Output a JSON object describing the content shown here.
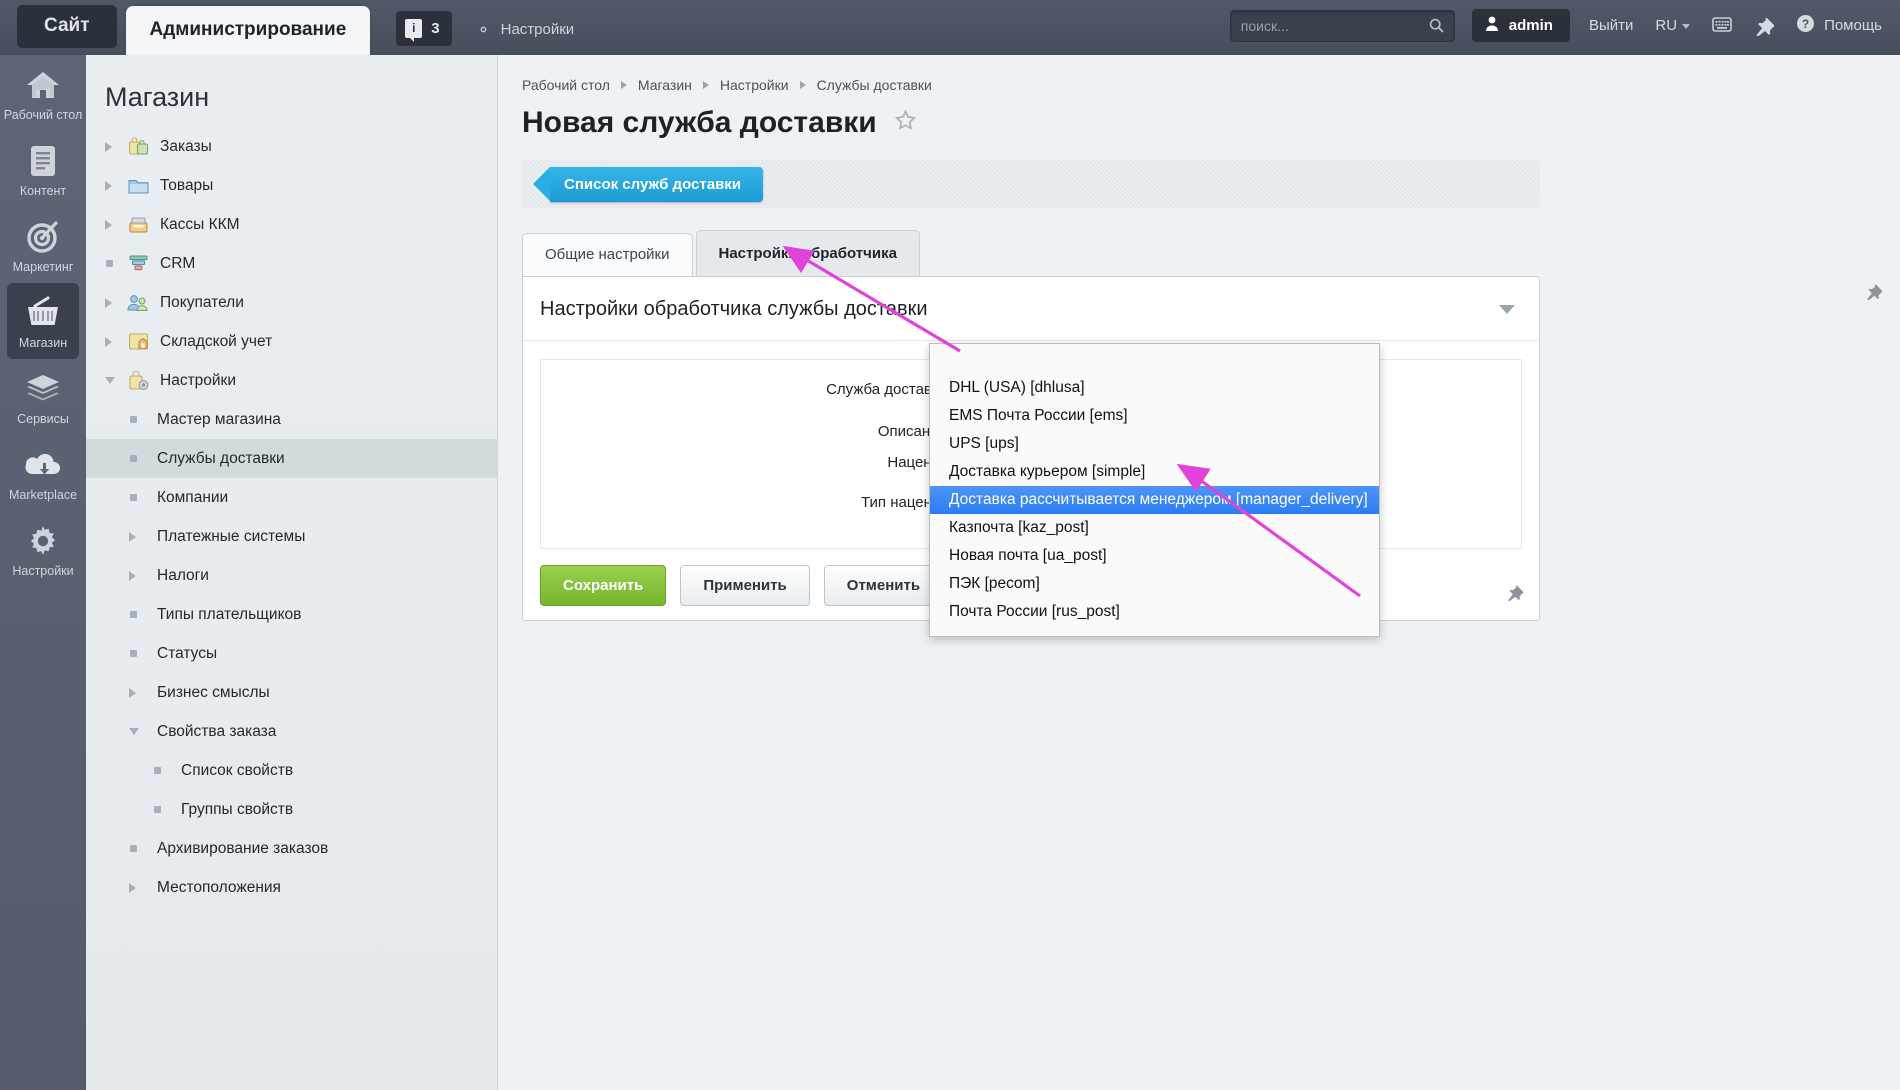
{
  "topbar": {
    "site_tab": "Сайт",
    "admin_tab": "Администрирование",
    "notify_count": "3",
    "settings_label": "Настройки",
    "search_placeholder": "поиск...",
    "user": "admin",
    "logout": "Выйти",
    "lang": "RU",
    "help": "Помощь"
  },
  "rail": {
    "items": [
      {
        "label": "Рабочий стол",
        "icon": "home-icon",
        "active": false
      },
      {
        "label": "Контент",
        "icon": "document-icon",
        "active": false
      },
      {
        "label": "Маркетинг",
        "icon": "target-icon",
        "active": false
      },
      {
        "label": "Магазин",
        "icon": "basket-icon",
        "active": true
      },
      {
        "label": "Сервисы",
        "icon": "layers-icon",
        "active": false
      },
      {
        "label": "Marketplace",
        "icon": "cloud-download-icon",
        "active": false
      },
      {
        "label": "Настройки",
        "icon": "gear-icon",
        "active": false
      }
    ]
  },
  "menu": {
    "title": "Магазин",
    "items": [
      {
        "label": "Заказы",
        "marker": "right",
        "level": 1,
        "icon": "bag-icon",
        "selected": false
      },
      {
        "label": "Товары",
        "marker": "right",
        "level": 1,
        "icon": "folder-icon",
        "selected": false
      },
      {
        "label": "Кассы ККМ",
        "marker": "right",
        "level": 1,
        "icon": "cashbox-icon",
        "selected": false
      },
      {
        "label": "CRM",
        "marker": "dot",
        "level": 1,
        "icon": "funnel-icon",
        "selected": false
      },
      {
        "label": "Покупатели",
        "marker": "right",
        "level": 1,
        "icon": "users-icon",
        "selected": false
      },
      {
        "label": "Складской учет",
        "marker": "right",
        "level": 1,
        "icon": "warehouse-icon",
        "selected": false
      },
      {
        "label": "Настройки",
        "marker": "down",
        "level": 1,
        "icon": "settings-bag-icon",
        "selected": false
      },
      {
        "label": "Мастер магазина",
        "marker": "dot",
        "level": 2,
        "icon": "",
        "selected": false
      },
      {
        "label": "Службы доставки",
        "marker": "dot",
        "level": 2,
        "icon": "",
        "selected": true
      },
      {
        "label": "Компании",
        "marker": "dot",
        "level": 2,
        "icon": "",
        "selected": false
      },
      {
        "label": "Платежные системы",
        "marker": "right",
        "level": 2,
        "icon": "",
        "selected": false
      },
      {
        "label": "Налоги",
        "marker": "right",
        "level": 2,
        "icon": "",
        "selected": false
      },
      {
        "label": "Типы плательщиков",
        "marker": "dot",
        "level": 2,
        "icon": "",
        "selected": false
      },
      {
        "label": "Статусы",
        "marker": "dot",
        "level": 2,
        "icon": "",
        "selected": false
      },
      {
        "label": "Бизнес смыслы",
        "marker": "right",
        "level": 2,
        "icon": "",
        "selected": false
      },
      {
        "label": "Свойства заказа",
        "marker": "down",
        "level": 2,
        "icon": "",
        "selected": false
      },
      {
        "label": "Список свойств",
        "marker": "dot",
        "level": 3,
        "icon": "",
        "selected": false
      },
      {
        "label": "Группы свойств",
        "marker": "dot",
        "level": 3,
        "icon": "",
        "selected": false
      },
      {
        "label": "Архивирование заказов",
        "marker": "dot",
        "level": 2,
        "icon": "",
        "selected": false
      },
      {
        "label": "Местоположения",
        "marker": "right",
        "level": 2,
        "icon": "",
        "selected": false
      }
    ]
  },
  "content": {
    "breadcrumbs": [
      "Рабочий стол",
      "Магазин",
      "Настройки",
      "Службы доставки"
    ],
    "page_title": "Новая служба доставки",
    "toolbar_button": "Список служб доставки",
    "tabs": [
      {
        "label": "Общие настройки",
        "active": false
      },
      {
        "label": "Настройки обработчика",
        "active": true
      }
    ],
    "panel_title": "Настройки обработчика службы доставки",
    "fields": [
      {
        "label": "Служба доставки:",
        "value": ""
      },
      {
        "label": "Описание:",
        "value": ""
      },
      {
        "label": "Наценка:",
        "value": ""
      },
      {
        "label": "Тип наценки:",
        "value": ""
      }
    ],
    "buttons": {
      "save": "Сохранить",
      "apply": "Применить",
      "cancel": "Отменить"
    }
  },
  "dropdown": {
    "options": [
      {
        "label": "DHL (USA) [dhlusa]",
        "selected": false
      },
      {
        "label": "EMS Почта России [ems]",
        "selected": false
      },
      {
        "label": "UPS [ups]",
        "selected": false
      },
      {
        "label": "Доставка курьером [simple]",
        "selected": false
      },
      {
        "label": "Доставка рассчитывается менеджером [manager_delivery]",
        "selected": true
      },
      {
        "label": "Казпочта [kaz_post]",
        "selected": false
      },
      {
        "label": "Новая почта [ua_post]",
        "selected": false
      },
      {
        "label": "ПЭК [pecom]",
        "selected": false
      },
      {
        "label": "Почта России [rus_post]",
        "selected": false
      }
    ]
  },
  "colors": {
    "accent_blue": "#27a9e0",
    "save_green": "#8cc63f",
    "annotation_pink": "#e342d8",
    "highlight_blue": "#3b8cf5"
  }
}
